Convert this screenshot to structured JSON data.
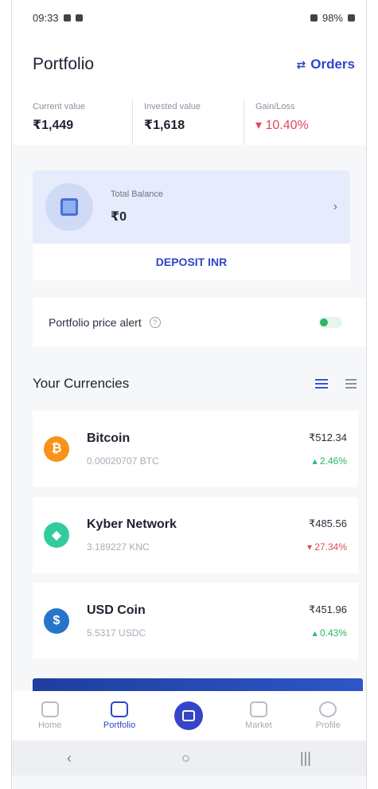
{
  "status_bar": {
    "time": "09:33",
    "right_text": "98%"
  },
  "header": {
    "title": "Portfolio",
    "orders_label": "Orders",
    "orders_icon": "swap-arrows-icon"
  },
  "summary": [
    {
      "label": "Current value",
      "value": "₹1,449"
    },
    {
      "label": "Invested value",
      "value": "₹1,618"
    },
    {
      "label": "Gain/Loss",
      "value": "▾ 10.40%"
    }
  ],
  "balance": {
    "label": "Total Balance",
    "value": "₹0",
    "deposit_label": "DEPOSIT INR"
  },
  "alert": {
    "label": "Portfolio price alert",
    "help": "?",
    "enabled": false
  },
  "currencies": {
    "title": "Your Currencies",
    "items": [
      {
        "name": "Bitcoin",
        "qty": "0.00020707 BTC",
        "price": "₹512.34",
        "change": "▴ 2.46%",
        "direction": "up",
        "logo": "bitcoin-icon",
        "logo_char": "₿",
        "color": "#f7931a"
      },
      {
        "name": "Kyber Network",
        "qty": "3.189227 KNC",
        "price": "₹485.56",
        "change": "▾ 27.34%",
        "direction": "down",
        "logo": "kyber-icon",
        "logo_char": "◆",
        "color": "#31cb9e"
      },
      {
        "name": "USD Coin",
        "qty": "5.5317 USDC",
        "price": "₹451.96",
        "change": "▴ 0.43%",
        "direction": "up",
        "logo": "usdc-icon",
        "logo_char": "$",
        "color": "#2775ca"
      }
    ]
  },
  "bottom_nav": [
    {
      "label": "Home",
      "icon": "home-icon",
      "active": false
    },
    {
      "label": "Portfolio",
      "icon": "folder-icon",
      "active": true
    },
    {
      "label": "",
      "icon": "gift-icon",
      "active": false
    },
    {
      "label": "Market",
      "icon": "chart-icon",
      "active": false
    },
    {
      "label": "Profile",
      "icon": "person-icon",
      "active": false
    }
  ],
  "system_nav": {
    "back": "‹",
    "home": "○",
    "recents": "|||"
  }
}
